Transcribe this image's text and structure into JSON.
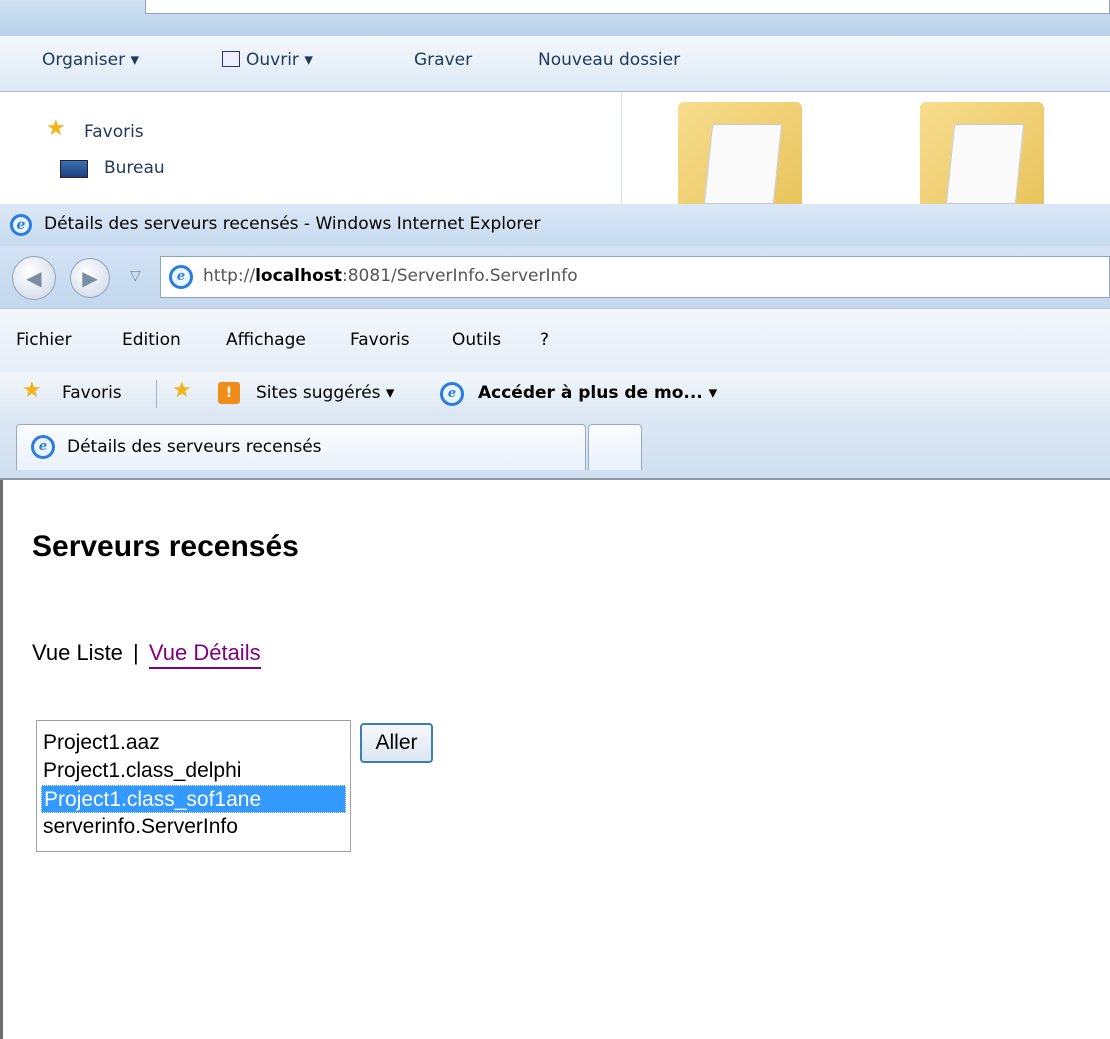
{
  "explorer": {
    "toolbar": {
      "organise": "Organiser ▾",
      "open": "Ouvrir ▾",
      "burn": "Graver",
      "new_folder": "Nouveau dossier"
    },
    "nav": {
      "favorites": "Favoris",
      "desktop": "Bureau"
    }
  },
  "ie": {
    "window_title": "Détails des serveurs recensés - Windows Internet Explorer",
    "address": {
      "prefix": "http://",
      "host": "localhost",
      "rest": ":8081/ServerInfo.ServerInfo"
    },
    "menu": [
      "Fichier",
      "Edition",
      "Affichage",
      "Favoris",
      "Outils",
      "?"
    ],
    "favorites_bar": {
      "favorites": "Favoris",
      "suggested_sites": "Sites suggérés ▾",
      "more_addons": "Accéder à plus de mo... ▾"
    },
    "tab": {
      "label": "Détails des serveurs recensés"
    }
  },
  "page": {
    "heading": "Serveurs recensés",
    "view_list": "Vue Liste",
    "separator": "|",
    "view_details": "Vue Détails",
    "servers": [
      "Project1.aaz",
      "Project1.class_delphi",
      "Project1.class_sof1ane",
      "serverinfo.ServerInfo"
    ],
    "selected_server": "Project1.class_sof1ane",
    "go_button": "Aller"
  },
  "colors": {
    "link_visited": "#800080",
    "selection": "#3399ff"
  }
}
